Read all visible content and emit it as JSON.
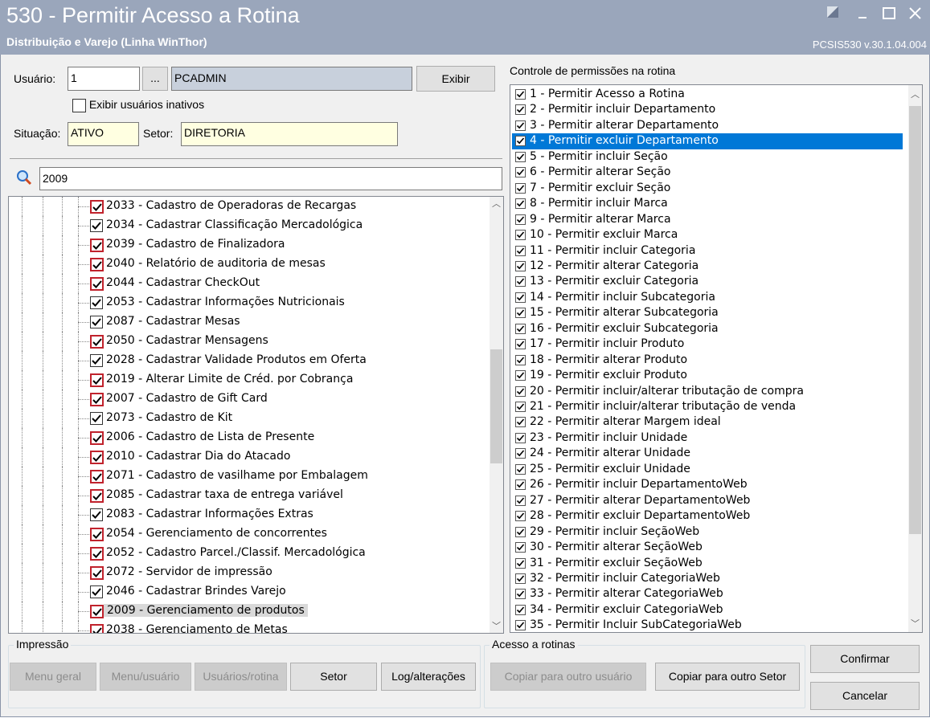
{
  "window": {
    "title": "530 - Permitir Acesso a Rotina",
    "subtitle": "Distribuição e Varejo (Linha WinThor)",
    "version": "PCSIS530  v.30.1.04.004"
  },
  "user": {
    "usuario_label": "Usuário:",
    "usuario_value": "1",
    "browse_label": "...",
    "username": "PCADMIN",
    "exibir_label": "Exibir",
    "inativos_label": "Exibir usuários inativos",
    "situacao_label": "Situação:",
    "situacao_value": "ATIVO",
    "setor_label": "Setor:",
    "setor_value": "DIRETORIA"
  },
  "search": {
    "value": "2009"
  },
  "routines": [
    {
      "label": "2033 - Cadastro de Operadoras de Recargas",
      "red": true
    },
    {
      "label": "2034 - Cadastrar Classificação Mercadológica",
      "red": false
    },
    {
      "label": "2039 - Cadastro de Finalizadora",
      "red": true
    },
    {
      "label": "2040 - Relatório de auditoria de mesas",
      "red": true
    },
    {
      "label": "2044 - Cadastrar CheckOut",
      "red": true
    },
    {
      "label": "2053 - Cadastrar Informações Nutricionais",
      "red": false
    },
    {
      "label": "2087 - Cadastrar Mesas",
      "red": false
    },
    {
      "label": "2050 - Cadastrar Mensagens",
      "red": true
    },
    {
      "label": "2028 - Cadastrar Validade Produtos em Oferta",
      "red": false
    },
    {
      "label": "2019 - Alterar Limite de Créd. por Cobrança",
      "red": true
    },
    {
      "label": "2007 - Cadastro de Gift Card",
      "red": true
    },
    {
      "label": "2073 - Cadastro de Kit",
      "red": false
    },
    {
      "label": "2006 - Cadastro de Lista de Presente",
      "red": true
    },
    {
      "label": "2010 - Cadastrar Dia do Atacado",
      "red": true
    },
    {
      "label": "2071 - Cadastro de vasilhame por Embalagem",
      "red": true
    },
    {
      "label": "2085 - Cadastrar taxa de entrega variável",
      "red": true
    },
    {
      "label": "2083 - Cadastrar Informações Extras",
      "red": false
    },
    {
      "label": "2054 - Gerenciamento de concorrentes",
      "red": true
    },
    {
      "label": "2052 - Cadastro Parcel./Classif. Mercadológica",
      "red": true
    },
    {
      "label": "2072 - Servidor de impressão",
      "red": true
    },
    {
      "label": "2046 - Cadastrar Brindes Varejo",
      "red": false
    },
    {
      "label": "2009 - Gerenciamento de produtos",
      "red": true,
      "selected": true
    },
    {
      "label": "2038 - Gerenciamento de Metas",
      "red": true
    }
  ],
  "permissions_title": "Controle de permissões na rotina",
  "permissions": [
    "1 - Permitir Acesso a Rotina",
    "2 - Permitir incluir Departamento",
    "3 - Permitir alterar Departamento",
    "4 - Permitir excluir Departamento",
    "5 - Permitir incluir Seção",
    "6 - Permitir alterar Seção",
    "7 - Permitir excluir Seção",
    "8 - Permitir incluir Marca",
    "9 - Permitir alterar Marca",
    "10 - Permitir excluir Marca",
    "11 - Permitir incluir Categoria",
    "12 - Permitir alterar Categoria",
    "13 - Permitir excluir Categoria",
    "14 - Permitir incluir Subcategoria",
    "15 - Permitir alterar Subcategoria",
    "16 - Permitir excluir Subcategoria",
    "17 - Permitir incluir Produto",
    "18 - Permitir alterar Produto",
    "19 - Permitir excluir Produto",
    "20 - Permitir incluir/alterar tributação de compra",
    "21 - Permitir incluir/alterar tributação de venda",
    "22 - Permitir alterar Margem ideal",
    "23 - Permitir incluir Unidade",
    "24 - Permitir alterar Unidade",
    "25 - Permitir excluir Unidade",
    "26 - Permitir incluir DepartamentoWeb",
    "27 - Permitir alterar DepartamentoWeb",
    "28 - Permitir excluir DepartamentoWeb",
    "29 - Permitir incluir SeçãoWeb",
    "30 - Permitir alterar SeçãoWeb",
    "31 - Permitir excluir SeçãoWeb",
    "32 - Permitir incluir CategoriaWeb",
    "33 - Permitir alterar CategoriaWeb",
    "34 - Permitir excluir CategoriaWeb",
    "35 - Permitir Incluir SubCategoriaWeb"
  ],
  "selected_permission_index": 3,
  "impressao": {
    "title": "Impressão",
    "menu_geral": "Menu geral",
    "menu_usuario": "Menu/usuário",
    "usuarios_rotina": "Usuários/rotina",
    "setor": "Setor",
    "log": "Log/alterações"
  },
  "acesso": {
    "title": "Acesso a rotinas",
    "copiar_usuario": "Copiar para outro usuário",
    "copiar_setor": "Copiar para outro Setor"
  },
  "actions": {
    "confirmar": "Confirmar",
    "cancelar": "Cancelar"
  },
  "colors": {
    "titlebar": "#9aa6bb",
    "selection": "#0078d7",
    "red_check": "#c0222c"
  }
}
